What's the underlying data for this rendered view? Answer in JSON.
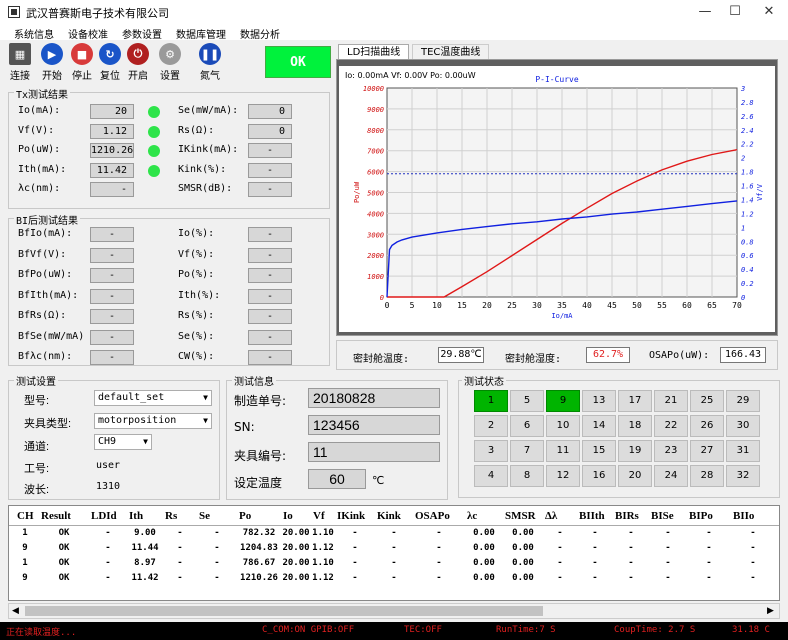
{
  "window": {
    "title": "武汉普赛斯电子技术有限公司",
    "minimize": "—",
    "maximize": "☐",
    "close": "✕"
  },
  "menu": [
    "系统信息",
    "设备校准",
    "参数设置",
    "数据库管理",
    "数据分析"
  ],
  "toolbar": [
    {
      "label": "连接",
      "icon": "connect-icon",
      "color": "#555555"
    },
    {
      "label": "开始",
      "icon": "play-icon",
      "color": "#1a55c8"
    },
    {
      "label": "停止",
      "icon": "stop-icon",
      "color": "#d83a3a"
    },
    {
      "label": "复位",
      "icon": "reset-icon",
      "color": "#1a55c8"
    },
    {
      "label": "开启",
      "icon": "power-icon",
      "color": "#b02020"
    },
    {
      "label": "设置",
      "icon": "gear-icon",
      "color": "#9a9a9a"
    },
    {
      "label": "氮气",
      "icon": "pause-icon",
      "color": "#1a4ab8"
    }
  ],
  "ok_label": "OK",
  "tx": {
    "title": "Tx测试结果",
    "left": [
      {
        "label": "Io(mA):",
        "value": "20",
        "led": true
      },
      {
        "label": "Vf(V):",
        "value": "1.12",
        "led": true
      },
      {
        "label": "Po(uW):",
        "value": "1210.26",
        "led": true
      },
      {
        "label": "Ith(mA):",
        "value": "11.42",
        "led": true
      },
      {
        "label": "λc(nm):",
        "value": "-",
        "led": false
      }
    ],
    "right": [
      {
        "label": "Se(mW/mA):",
        "value": "0"
      },
      {
        "label": "Rs(Ω):",
        "value": "0"
      },
      {
        "label": "IKink(mA):",
        "value": "-"
      },
      {
        "label": "Kink(%):",
        "value": "-"
      },
      {
        "label": "SMSR(dB):",
        "value": "-"
      }
    ]
  },
  "bi": {
    "title": "BI后测试结果",
    "left": [
      {
        "label": "BfIo(mA):",
        "value": "-"
      },
      {
        "label": "BfVf(V):",
        "value": "-"
      },
      {
        "label": "BfPo(uW):",
        "value": "-"
      },
      {
        "label": "BfIth(mA):",
        "value": "-"
      },
      {
        "label": "BfRs(Ω):",
        "value": "-"
      },
      {
        "label": "BfSe(mW/mA)",
        "value": "-"
      },
      {
        "label": "Bfλc(nm):",
        "value": "-"
      }
    ],
    "right": [
      {
        "label": "Io(%):",
        "value": "-"
      },
      {
        "label": "Vf(%):",
        "value": "-"
      },
      {
        "label": "Po(%):",
        "value": "-"
      },
      {
        "label": "Ith(%):",
        "value": "-"
      },
      {
        "label": "Rs(%):",
        "value": "-"
      },
      {
        "label": "Se(%):",
        "value": "-"
      },
      {
        "label": "CW(%):",
        "value": "-"
      }
    ]
  },
  "tabs": [
    "LD扫描曲线",
    "TEC温度曲线"
  ],
  "chart_info": "Io: 0.00mA  Vf: 0.00V  Po: 0.00uW",
  "chart_data": {
    "type": "line",
    "title": "P-I-Curve",
    "xlabel": "Io/mA",
    "ylabel": "Po/uW",
    "y2label": "Vf/V",
    "xlim": [
      0,
      70
    ],
    "ylim": [
      0,
      10000
    ],
    "y2lim": [
      0,
      3
    ],
    "xticks": [
      "0",
      "5",
      "10",
      "15",
      "20",
      "25",
      "30",
      "35",
      "40",
      "45",
      "50",
      "55",
      "60",
      "65",
      "70"
    ],
    "yticks": [
      "0",
      "1000",
      "2000",
      "3000",
      "4000",
      "5000",
      "6000",
      "7000",
      "8000",
      "9000",
      "10000"
    ],
    "y2ticks": [
      "0",
      "0.2",
      "0.4",
      "0.6",
      "0.8",
      "1",
      "1.2",
      "1.4",
      "1.6",
      "1.8",
      "2",
      "2.2",
      "2.4",
      "2.6",
      "2.8",
      "3"
    ],
    "series": [
      {
        "axis": "left",
        "color": "#e01818",
        "x": [
          0,
          5,
          10,
          11.42,
          15,
          20,
          25,
          30,
          35,
          40,
          45,
          50,
          55,
          60,
          65,
          70
        ],
        "y": [
          0,
          0,
          0,
          0,
          500,
          1210,
          1980,
          2750,
          3520,
          4250,
          4950,
          5550,
          6080,
          6500,
          6820,
          7050
        ]
      },
      {
        "axis": "right",
        "color": "#1020e0",
        "x": [
          0,
          0.5,
          1,
          2,
          3,
          5,
          10,
          15,
          20,
          25,
          30,
          35,
          40,
          45,
          50,
          55,
          60,
          65,
          70
        ],
        "y": [
          0,
          0.68,
          0.74,
          0.79,
          0.82,
          0.86,
          0.92,
          0.97,
          1.01,
          1.05,
          1.08,
          1.12,
          1.15,
          1.19,
          1.22,
          1.26,
          1.3,
          1.34,
          1.38
        ]
      }
    ],
    "ref_line": {
      "axis": "left",
      "y": 5900
    }
  },
  "status": {
    "temp_label": "密封舱温度:",
    "temp": "29.88℃",
    "hum_label": "密封舱湿度:",
    "hum": "62.7%",
    "osa_label": "OSAPo(uW):",
    "osa": "166.43"
  },
  "settings": {
    "title": "测试设置",
    "model_label": "型号:",
    "model": "default_set",
    "fixture_label": "夹具类型:",
    "fixture": "motorposition",
    "channel_label": "通道:",
    "channel": "CH9",
    "worker_label": "工号:",
    "worker": "user",
    "wave_label": "波长:",
    "wave": "1310"
  },
  "info": {
    "title": "测试信息",
    "order_label": "制造单号:",
    "order": "20180828",
    "sn_label": "SN:",
    "sn": "123456",
    "fixno_label": "夹具编号:",
    "fixno": "11",
    "temp_label": "设定温度",
    "temp": "60",
    "unit": "℃"
  },
  "slots": {
    "title": "测试状态",
    "cells": [
      [
        "1",
        "5",
        "9",
        "13",
        "17",
        "21",
        "25",
        "29"
      ],
      [
        "2",
        "6",
        "10",
        "14",
        "18",
        "22",
        "26",
        "30"
      ],
      [
        "3",
        "7",
        "11",
        "15",
        "19",
        "23",
        "27",
        "31"
      ],
      [
        "4",
        "8",
        "12",
        "16",
        "20",
        "24",
        "28",
        "32"
      ]
    ],
    "active": [
      "1",
      "9"
    ]
  },
  "table": {
    "headers": [
      "CH",
      "Result",
      "LDId",
      "Ith",
      "Rs",
      "Se",
      "Po",
      "Io",
      "Vf",
      "IKink",
      "Kink",
      "OSAPo",
      "λc",
      "SMSR",
      "Δλ",
      "BIIth",
      "BIRs",
      "BISe",
      "BIPo",
      "BIIo"
    ],
    "rows": [
      [
        "1",
        "OK",
        "-",
        "9.00",
        "-",
        "-",
        "782.32",
        "20.00",
        "1.10",
        "-",
        "-",
        "-",
        "0.00",
        "0.00",
        "-",
        "-",
        "-",
        "-",
        "-",
        "-"
      ],
      [
        "9",
        "OK",
        "-",
        "11.44",
        "-",
        "-",
        "1204.83",
        "20.00",
        "1.12",
        "-",
        "-",
        "-",
        "0.00",
        "0.00",
        "-",
        "-",
        "-",
        "-",
        "-",
        "-"
      ],
      [
        "1",
        "OK",
        "-",
        "8.97",
        "-",
        "-",
        "786.67",
        "20.00",
        "1.10",
        "-",
        "-",
        "-",
        "0.00",
        "0.00",
        "-",
        "-",
        "-",
        "-",
        "-",
        "-"
      ],
      [
        "9",
        "OK",
        "-",
        "11.42",
        "-",
        "-",
        "1210.26",
        "20.00",
        "1.12",
        "-",
        "-",
        "-",
        "0.00",
        "0.00",
        "-",
        "-",
        "-",
        "-",
        "-",
        "-"
      ]
    ]
  },
  "statusbar": [
    "正在读取温度...",
    "C_COM:ON GPIB:OFF",
    "TEC:OFF",
    "RunTime:7 S",
    "CoupTime: 2.7 S",
    "31.18 C"
  ]
}
